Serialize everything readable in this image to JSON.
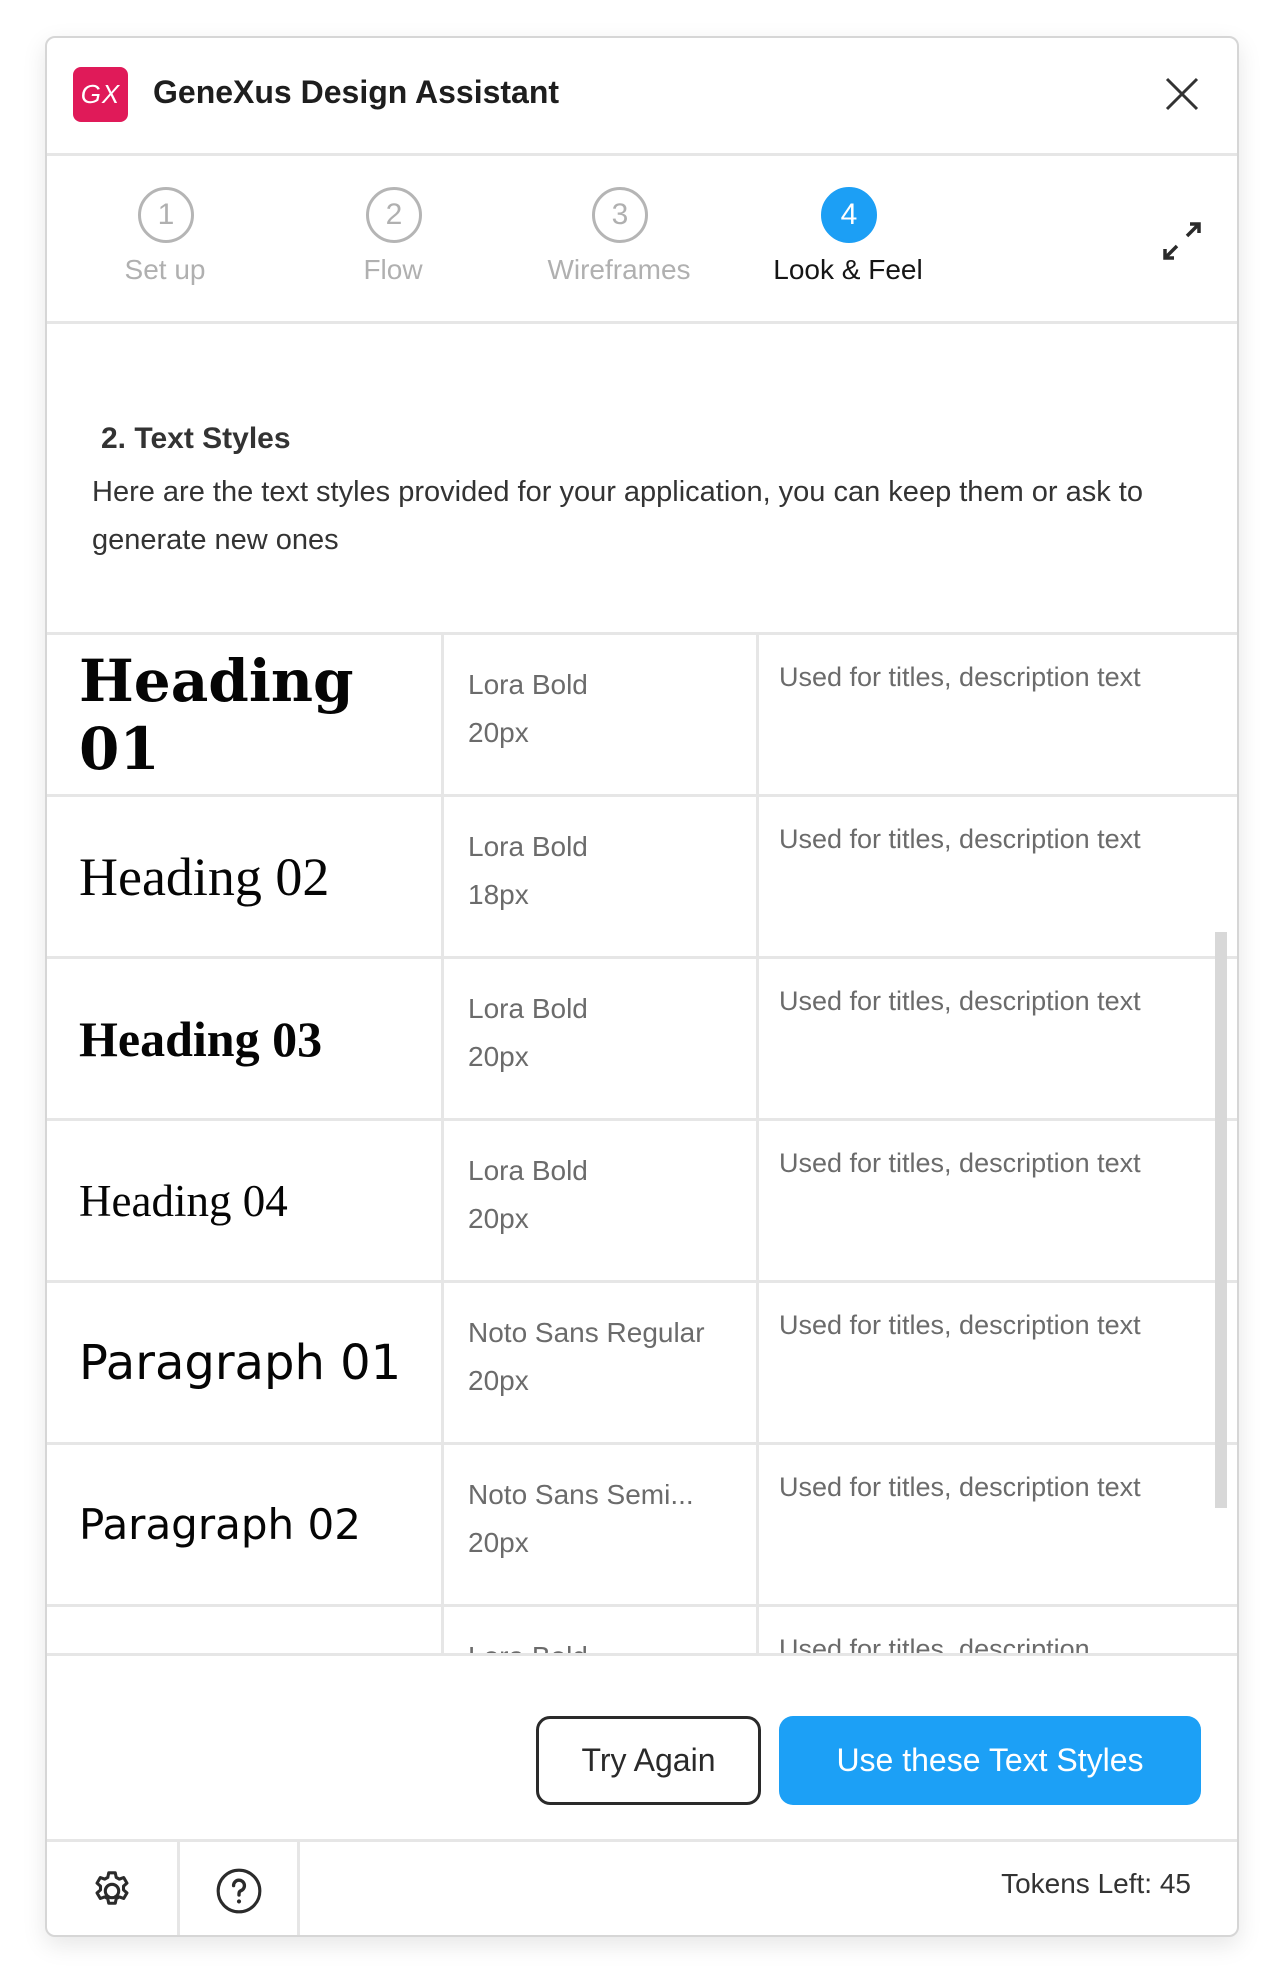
{
  "app": {
    "logo_text": "GX",
    "title": "GeneXus Design Assistant",
    "brand_color": "#E01A59",
    "accent_color": "#1CA0F6"
  },
  "steps": [
    {
      "number": "1",
      "label": "Set up",
      "active": false
    },
    {
      "number": "2",
      "label": "Flow",
      "active": false
    },
    {
      "number": "3",
      "label": "Wireframes",
      "active": false
    },
    {
      "number": "4",
      "label": "Look & Feel",
      "active": true
    }
  ],
  "icons": {
    "close": "close-icon",
    "expand": "expand-icon",
    "settings": "gear-icon",
    "help": "help-icon"
  },
  "section": {
    "title": "2. Text Styles",
    "description": "Here are the text styles provided for your application, you can keep them or ask to generate new ones"
  },
  "text_styles": [
    {
      "name": "Heading 01",
      "font": "Lora Bold",
      "size": "20px",
      "description": "Used for titles, description text"
    },
    {
      "name": "Heading 02",
      "font": "Lora Bold",
      "size": "18px",
      "description": "Used for titles, description text"
    },
    {
      "name": "Heading 03",
      "font": "Lora Bold",
      "size": "20px",
      "description": "Used for titles, description text"
    },
    {
      "name": "Heading 04",
      "font": "Lora Bold",
      "size": "20px",
      "description": "Used for titles, description text"
    },
    {
      "name": "Paragraph 01",
      "font": "Noto Sans Regular",
      "size": "20px",
      "description": "Used for titles, description text"
    },
    {
      "name": "Paragraph 02",
      "font": "Noto Sans Semi...",
      "size": "20px",
      "description": "Used for titles, description text"
    },
    {
      "name": "",
      "font": "Lora Bold",
      "size": "",
      "description": "Used for titles, description"
    }
  ],
  "actions": {
    "try_again": "Try Again",
    "use_styles": "Use these Text Styles"
  },
  "footer": {
    "tokens_label": "Tokens Left: 45"
  }
}
